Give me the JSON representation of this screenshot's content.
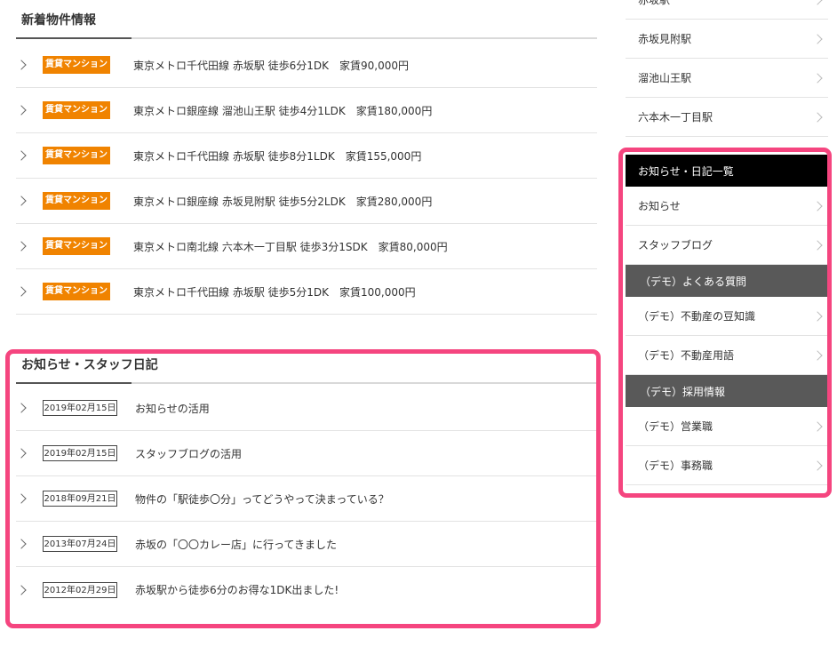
{
  "properties_section": {
    "title": "新着物件情報",
    "items": [
      {
        "badge": "賃貸マンション",
        "text": "東京メトロ千代田線 赤坂駅 徒歩6分1DK　家賃90,000円"
      },
      {
        "badge": "賃貸マンション",
        "text": "東京メトロ銀座線 溜池山王駅 徒歩4分1LDK　家賃180,000円"
      },
      {
        "badge": "賃貸マンション",
        "text": "東京メトロ千代田線 赤坂駅 徒歩8分1LDK　家賃155,000円"
      },
      {
        "badge": "賃貸マンション",
        "text": "東京メトロ銀座線 赤坂見附駅 徒歩5分2LDK　家賃280,000円"
      },
      {
        "badge": "賃貸マンション",
        "text": "東京メトロ南北線 六本木一丁目駅 徒歩3分1SDK　家賃80,000円"
      },
      {
        "badge": "賃貸マンション",
        "text": "東京メトロ千代田線 赤坂駅 徒歩5分1DK　家賃100,000円"
      }
    ]
  },
  "news_section": {
    "title": "お知らせ・スタッフ日記",
    "items": [
      {
        "date": "2019年02月15日",
        "text": "お知らせの活用"
      },
      {
        "date": "2019年02月15日",
        "text": "スタッフブログの活用"
      },
      {
        "date": "2018年09月21日",
        "text": "物件の「駅徒歩〇分」ってどうやって決まっている？"
      },
      {
        "date": "2013年07月24日",
        "text": "赤坂の「〇〇カレー店」に行ってきました"
      },
      {
        "date": "2012年02月29日",
        "text": "赤坂駅から徒歩6分のお得な1DK出ました!"
      }
    ]
  },
  "sidebar": {
    "stations": [
      "赤坂駅",
      "赤坂見附駅",
      "溜池山王駅",
      "六本木一丁目駅"
    ],
    "news_heading": "お知らせ・日記一覧",
    "news_links": [
      "お知らせ",
      "スタッフブログ"
    ],
    "cat_faq": "（デモ）よくある質問",
    "faq_links": [
      "（デモ）不動産の豆知識",
      "（デモ）不動産用語"
    ],
    "cat_recruit": "（デモ）採用情報",
    "recruit_links": [
      "（デモ）営業職",
      "（デモ）事務職"
    ]
  },
  "colors": {
    "badge": "#f08300",
    "highlight": "#f5457f",
    "category_bg": "#595959",
    "heading_bg": "#000000"
  }
}
